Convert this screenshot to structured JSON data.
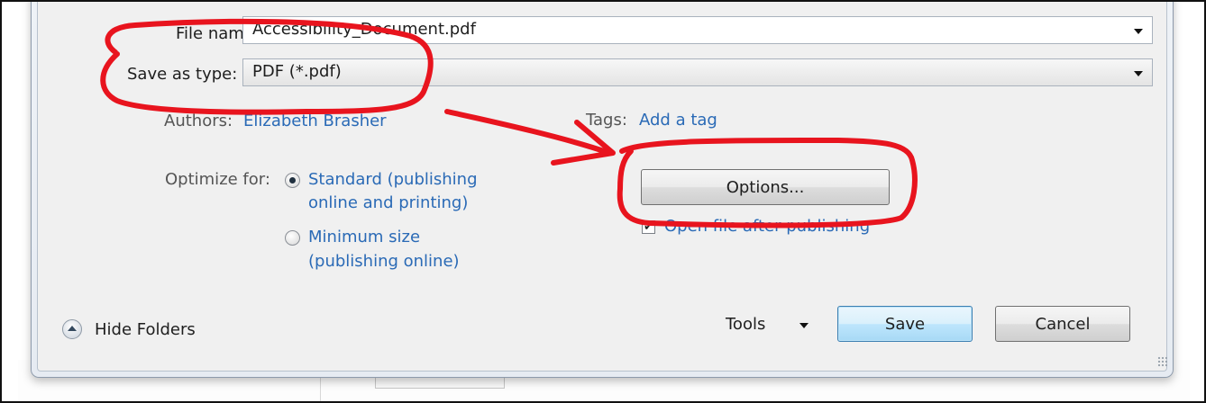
{
  "dialog": {
    "file_name": {
      "label": "File name:",
      "value": "Accessibility_Document.pdf"
    },
    "save_as_type": {
      "label": "Save as type:",
      "value": "PDF (*.pdf)"
    },
    "authors": {
      "label": "Authors:",
      "value": "Elizabeth Brasher"
    },
    "tags": {
      "label": "Tags:",
      "value": "Add a tag"
    },
    "optimize": {
      "label": "Optimize for:",
      "options": [
        {
          "line1": "Standard (publishing",
          "line2": "online and printing)",
          "selected": true
        },
        {
          "line1": "Minimum size",
          "line2": "(publishing online)",
          "selected": false
        }
      ]
    },
    "options_button": "Options...",
    "open_after": {
      "label": "Open file after publishing",
      "checked": true
    },
    "hide_folders": "Hide Folders",
    "tools": "Tools",
    "save": "Save",
    "cancel": "Cancel"
  },
  "annotation_color": "#e8141e",
  "icons": [
    "chevron-down-icon",
    "radio-icon",
    "checkbox-icon",
    "hide-folders-icon",
    "resize-grip-icon",
    "arrow-annotation"
  ]
}
